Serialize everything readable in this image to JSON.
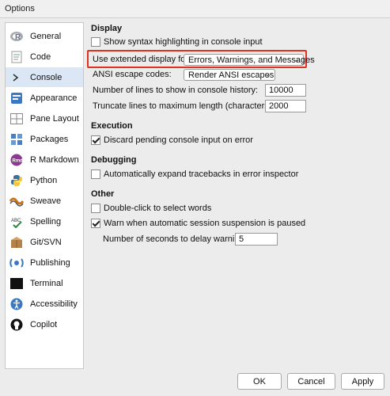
{
  "window": {
    "title": "Options"
  },
  "sidebar": {
    "items": [
      {
        "label": "General",
        "icon": "r-logo-icon"
      },
      {
        "label": "Code",
        "icon": "code-page-icon"
      },
      {
        "label": "Console",
        "icon": "console-prompt-icon"
      },
      {
        "label": "Appearance",
        "icon": "appearance-icon"
      },
      {
        "label": "Pane Layout",
        "icon": "pane-layout-icon"
      },
      {
        "label": "Packages",
        "icon": "packages-icon"
      },
      {
        "label": "R Markdown",
        "icon": "rmd-icon"
      },
      {
        "label": "Python",
        "icon": "python-icon"
      },
      {
        "label": "Sweave",
        "icon": "sweave-icon"
      },
      {
        "label": "Spelling",
        "icon": "spelling-icon"
      },
      {
        "label": "Git/SVN",
        "icon": "git-svn-icon"
      },
      {
        "label": "Publishing",
        "icon": "publishing-icon"
      },
      {
        "label": "Terminal",
        "icon": "terminal-icon"
      },
      {
        "label": "Accessibility",
        "icon": "accessibility-icon"
      },
      {
        "label": "Copilot",
        "icon": "copilot-icon"
      }
    ],
    "selected": "Console"
  },
  "display": {
    "heading": "Display",
    "syntax_highlighting": {
      "label": "Show syntax highlighting in console input",
      "checked": false
    },
    "extended_display": {
      "label": "Use extended display for:",
      "value": "Errors, Warnings, and Messages"
    },
    "ansi": {
      "label": "ANSI escape codes:",
      "value": "Render ANSI escapes"
    },
    "history_lines": {
      "label": "Number of lines to show in console history:",
      "value": "10000"
    },
    "truncate_lines": {
      "label": "Truncate lines to maximum length (characters):",
      "value": "2000"
    }
  },
  "execution": {
    "heading": "Execution",
    "discard_pending": {
      "label": "Discard pending console input on error",
      "checked": true
    }
  },
  "debugging": {
    "heading": "Debugging",
    "expand_tracebacks": {
      "label": "Automatically expand tracebacks in error inspector",
      "checked": false
    }
  },
  "other": {
    "heading": "Other",
    "double_click": {
      "label": "Double-click to select words",
      "checked": false
    },
    "warn_suspension": {
      "label": "Warn when automatic session suspension is paused",
      "checked": true
    },
    "delay_warning": {
      "label": "Number of seconds to delay warning:",
      "value": "5"
    }
  },
  "buttons": {
    "ok": "OK",
    "cancel": "Cancel",
    "apply": "Apply"
  },
  "colors": {
    "highlight": "#e0331f",
    "selected_bg": "#dbe7f5"
  }
}
